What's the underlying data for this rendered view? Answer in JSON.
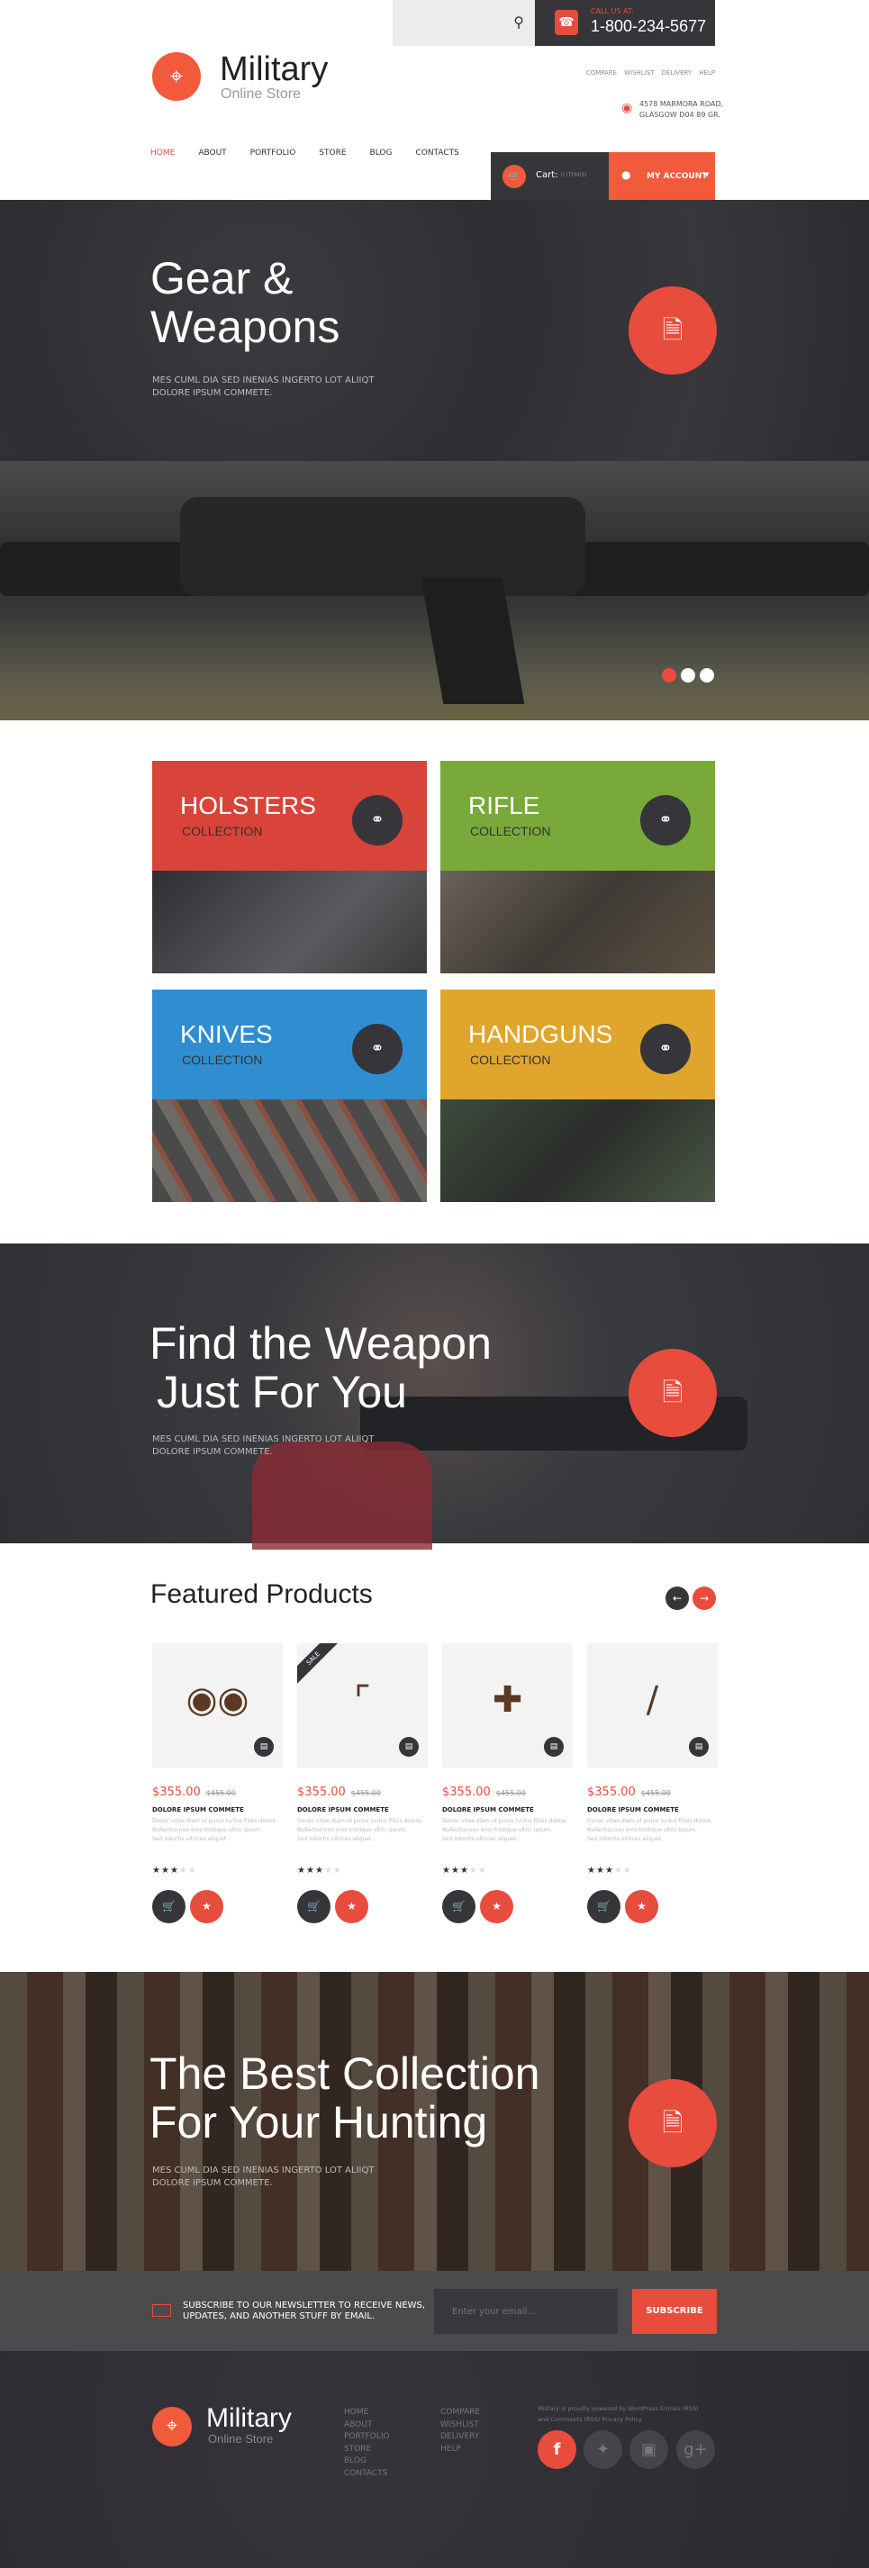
{
  "header": {
    "call_label": "CALL US AT:",
    "phone": "1-800-234-5677",
    "brand": "Military",
    "tagline": "Online Store",
    "top_links": [
      "COMPARE",
      "WISHLIST",
      "DELIVERY",
      "HELP"
    ],
    "address_line1": "4578 MARMORA ROAD,",
    "address_line2": "GLASGOW D04 89 GR.",
    "nav": [
      "HOME",
      "ABOUT",
      "PORTFOLIO",
      "STORE",
      "BLOG",
      "CONTACTS"
    ],
    "cart_label": "Cart:",
    "cart_count": "0 ITEM(S)",
    "account_label": "MY ACCOUNT"
  },
  "hero": {
    "title1": "Gear &",
    "title2": "Weapons",
    "sub1": "MES CUML DIA SED INENIAS INGERTO LOT ALIIQT",
    "sub2": "DOLORE IPSUM COMMETE."
  },
  "collections": [
    {
      "title": "HOLSTERS",
      "sub": "COLLECTION",
      "color": "#d8433a"
    },
    {
      "title": "RIFLE",
      "sub": "COLLECTION",
      "color": "#78a93a"
    },
    {
      "title": "KNIVES",
      "sub": "COLLECTION",
      "color": "#2f8dd0"
    },
    {
      "title": "HANDGUNS",
      "sub": "COLLECTION",
      "color": "#e0a52c"
    }
  ],
  "promo1": {
    "title1": "Find the Weapon",
    "title2": "Just For You",
    "sub1": "MES CUML DIA SED INENIAS INGERTO LOT ALIIQT",
    "sub2": "DOLORE IPSUM COMMETE."
  },
  "featured": {
    "title": "Featured Products",
    "sale_label": "SALE",
    "products": [
      {
        "icon": "binoculars",
        "price": "$355.00",
        "old": "$455.00",
        "name": "DOLORE IPSUM COMMETE",
        "d1": "Donec vitae diam ut purus luctus filisis dolore.",
        "d2": "Nullectus non eros tristique ultric ipsum.",
        "d3": "Sed lobortis ultrices aliquet.",
        "rating": 3
      },
      {
        "icon": "scoped-pistol",
        "price": "$355.00",
        "old": "$455.00",
        "name": "DOLORE IPSUM COMMETE",
        "d1": "Donec vitae diam ut purus luctus filisis dolore.",
        "d2": "Nullectus non eros tristique ultric ipsum.",
        "d3": "Sed lobortis ultrices aliquet.",
        "rating": 3
      },
      {
        "icon": "crossbow",
        "price": "$355.00",
        "old": "$455.00",
        "name": "DOLORE IPSUM COMMETE",
        "d1": "Donec vitae diam ut purus luctus filisis dolore.",
        "d2": "Nullectus non eros tristique ultric ipsum.",
        "d3": "Sed lobortis ultrices aliquet.",
        "rating": 3
      },
      {
        "icon": "shotgun",
        "price": "$355.00",
        "old": "$455.00",
        "name": "DOLORE IPSUM COMMETE",
        "d1": "Donec vitae diam ut purus luctus filisis dolore.",
        "d2": "Nullectus non eros tristique ultric ipsum.",
        "d3": "Sed lobortis ultrices aliquet.",
        "rating": 3
      }
    ]
  },
  "promo2": {
    "title1": "The Best Collection",
    "title2": "For Your Hunting",
    "sub1": "MES CUML DIA SED INENIAS INGERTO LOT ALIIQT",
    "sub2": "DOLORE IPSUM COMMETE."
  },
  "newsletter": {
    "text1": "SUBSCRIBE TO OUR NEWSLETTER TO RECEIVE NEWS,",
    "text2": "UPDATES, AND ANOTHER STUFF BY EMAIL.",
    "placeholder": "Enter your email...",
    "button": "SUBSCRIBE"
  },
  "footer": {
    "brand": "Military",
    "tagline": "Online Store",
    "col1": [
      "HOME",
      "ABOUT",
      "PORTFOLIO",
      "STORE",
      "BLOG",
      "CONTACTS"
    ],
    "col2": [
      "COMPARE",
      "WISHLIST",
      "DELIVERY",
      "HELP"
    ],
    "credits1": "Military is proudly powered by WordPress Entries (RSS)",
    "credits2": "and Comments (RSS) Privacy Policy",
    "social": [
      "facebook",
      "twitter",
      "instagram",
      "google-plus"
    ]
  },
  "colors": {
    "accent": "#e84c3d",
    "dark": "#36353a"
  }
}
